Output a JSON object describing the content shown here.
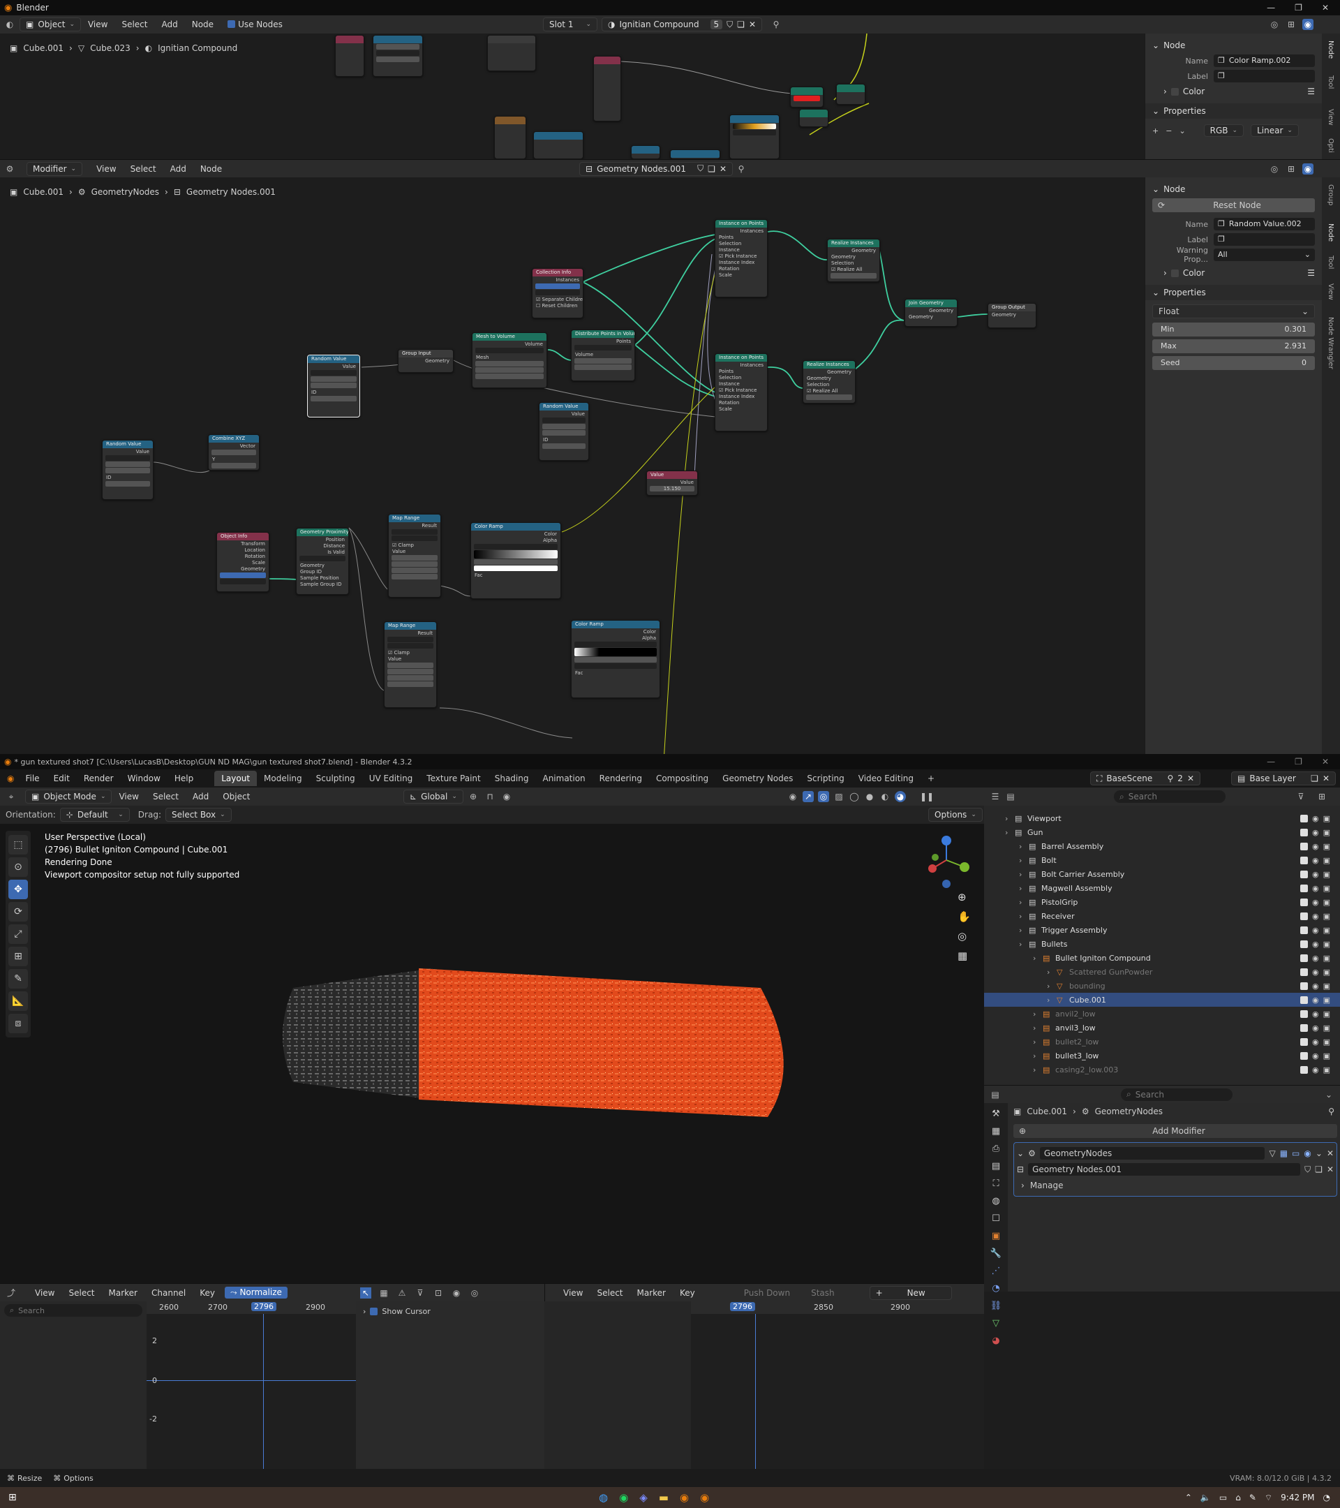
{
  "window_title": "Blender",
  "window_title2": "* gun textured shot7 [C:\\Users\\LucasB\\Desktop\\GUN ND MAG\\gun textured shot7.blend] - Blender 4.3.2",
  "shader_editor": {
    "mode_dropdown": "Object",
    "menus": [
      "View",
      "Select",
      "Add",
      "Node"
    ],
    "use_nodes_label": "Use Nodes",
    "slot": "Slot 1",
    "material_name": "Ignitian Compound",
    "material_users": "5",
    "breadcrumb": [
      "Cube.001",
      "Cube.023",
      "Ignitian Compound"
    ],
    "sidebar": {
      "node_header": "Node",
      "name_label": "Name",
      "name_value": "Color Ramp.002",
      "label_label": "Label",
      "color_label": "Color",
      "properties_header": "Properties",
      "color_mode": "RGB",
      "interpolation": "Linear"
    }
  },
  "geo_editor": {
    "mode_dropdown": "Modifier",
    "menus": [
      "View",
      "Select",
      "Add",
      "Node"
    ],
    "node_group": "Geometry Nodes.001",
    "breadcrumb": [
      "Cube.001",
      "GeometryNodes",
      "Geometry Nodes.001"
    ],
    "sidebar": {
      "node_header": "Node",
      "reset_label": "Reset Node",
      "name_label": "Name",
      "name_value": "Random Value.002",
      "label_label": "Label",
      "warning_label": "Warning Prop...",
      "warning_value": "All",
      "color_label": "Color",
      "properties_header": "Properties",
      "data_type": "Float",
      "min_label": "Min",
      "min_value": "0.301",
      "max_label": "Max",
      "max_value": "2.931",
      "seed_label": "Seed",
      "seed_value": "0"
    },
    "nodes": {
      "instance_points_1": "Instance on Points",
      "instance_points_2": "Instance on Points",
      "realize_1": "Realize Instances",
      "realize_2": "Realize Instances",
      "join": "Join Geometry",
      "group_output": "Group Output",
      "collection_info": "Collection Info",
      "group_input": "Group Input",
      "mesh_to_volume": "Mesh to Volume",
      "distribute_volume": "Distribute Points in Volume",
      "random_value_sel": "Random Value",
      "random_value_2": "Random Value",
      "random_value_3": "Random Value",
      "combine_xyz": "Combine XYZ",
      "value": "Value",
      "value_num": "15.150",
      "object_info": "Object Info",
      "geometry_proximity": "Geometry Proximity",
      "map_range_1": "Map Range",
      "map_range_2": "Map Range",
      "color_ramp_1": "Color Ramp",
      "color_ramp_2": "Color Ramp"
    }
  },
  "main_menu": [
    "File",
    "Edit",
    "Render",
    "Window",
    "Help"
  ],
  "workspace_tabs": [
    "Layout",
    "Modeling",
    "Sculpting",
    "UV Editing",
    "Texture Paint",
    "Shading",
    "Animation",
    "Rendering",
    "Compositing",
    "Geometry Nodes",
    "Scripting",
    "Video Editing"
  ],
  "scene_name": "BaseScene",
  "scene_users": "2",
  "view_layer": "Base Layer",
  "viewport": {
    "mode": "Object Mode",
    "menus": [
      "View",
      "Select",
      "Add",
      "Object"
    ],
    "transform": "Global",
    "orientation_label": "Orientation:",
    "orientation_value": "Default",
    "drag_label": "Drag:",
    "drag_value": "Select Box",
    "options_label": "Options",
    "overlay_lines": [
      "User Perspective (Local)",
      "(2796) Bullet Igniton Compound | Cube.001",
      "Rendering Done",
      "Viewport compositor setup not fully supported"
    ]
  },
  "outliner": {
    "search_placeholder": "Search",
    "items": [
      {
        "label": "Viewport",
        "depth": 1,
        "dim": false
      },
      {
        "label": "Gun",
        "depth": 1,
        "dim": false
      },
      {
        "label": "Barrel Assembly",
        "depth": 2,
        "dim": false
      },
      {
        "label": "Bolt",
        "depth": 2,
        "dim": false
      },
      {
        "label": "Bolt Carrier Assembly",
        "depth": 2,
        "dim": false
      },
      {
        "label": "Magwell Assembly",
        "depth": 2,
        "dim": false
      },
      {
        "label": "PistolGrip",
        "depth": 2,
        "dim": false
      },
      {
        "label": "Receiver",
        "depth": 2,
        "dim": false
      },
      {
        "label": "Trigger Assembly",
        "depth": 2,
        "dim": false
      },
      {
        "label": "Bullets",
        "depth": 2,
        "dim": false
      },
      {
        "label": "Bullet Igniton Compound",
        "depth": 3,
        "dim": false
      },
      {
        "label": "Scattered GunPowder",
        "depth": 4,
        "dim": true
      },
      {
        "label": "bounding",
        "depth": 4,
        "dim": true
      },
      {
        "label": "Cube.001",
        "depth": 4,
        "dim": false
      },
      {
        "label": "anvil2_low",
        "depth": 3,
        "dim": true
      },
      {
        "label": "anvil3_low",
        "depth": 3,
        "dim": false
      },
      {
        "label": "bullet2_low",
        "depth": 3,
        "dim": true
      },
      {
        "label": "bullet3_low",
        "depth": 3,
        "dim": false
      },
      {
        "label": "casing2_low.003",
        "depth": 3,
        "dim": true
      }
    ]
  },
  "properties": {
    "search_placeholder": "Search",
    "breadcrumb": [
      "Cube.001",
      "GeometryNodes"
    ],
    "add_modifier": "Add Modifier",
    "modifier_name": "GeometryNodes",
    "node_group": "Geometry Nodes.001",
    "manage": "Manage"
  },
  "graph_editor": {
    "menus": [
      "View",
      "Select",
      "Marker",
      "Channel",
      "Key"
    ],
    "normalize": "Normalize",
    "search_placeholder": "Search",
    "frames": [
      "2600",
      "2700",
      "2796",
      "2900"
    ],
    "y_labels": [
      "2",
      "0",
      "-2"
    ],
    "show_cursor": "Show Cursor"
  },
  "nla_editor": {
    "menus": [
      "View",
      "Select",
      "Marker",
      "Key"
    ],
    "push_down": "Push Down",
    "stash": "Stash",
    "new": "New",
    "frames": [
      "2796",
      "2850",
      "2900"
    ]
  },
  "status_bar": {
    "resize": "Resize",
    "options": "Options",
    "vram": "VRAM: 8.0/12.0 GiB | 4.3.2"
  },
  "taskbar": {
    "time": "9:42 PM"
  },
  "colors": {
    "accent": "#3d6ab2",
    "geometry_header": "#1d725e",
    "input_header": "#83314a",
    "converter_header": "#246283",
    "orange_cube": "#e24a1c",
    "wire": "#3fd0a0"
  }
}
